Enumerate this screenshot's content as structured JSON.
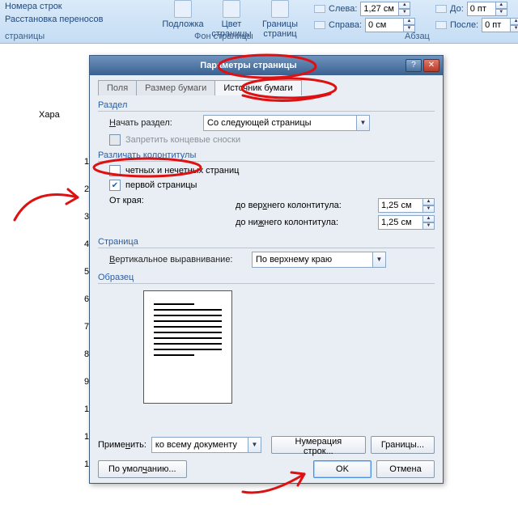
{
  "ribbon": {
    "items": {
      "line_numbers": "Номера строк",
      "hyphenation": "Расстановка переносов",
      "watermark": "Подложка",
      "page_color": "Цвет\nстраницы",
      "borders": "Границы\nстраниц"
    },
    "groups": {
      "page_setup": "страницы",
      "page_background": "Фон страницы",
      "paragraph": "Абзац"
    },
    "indent": {
      "left_label": "Слева:",
      "left_value": "1,27 см",
      "right_label": "Справа:",
      "right_value": "0 см"
    },
    "spacing": {
      "before_label": "До:",
      "before_value": "0 пт",
      "after_label": "После:",
      "after_value": "0 пт"
    }
  },
  "doc": {
    "text1": "Хара",
    "nums": [
      "1",
      "2",
      "3",
      "4",
      "5",
      "6",
      "7",
      "8",
      "9",
      "1",
      "1",
      "1"
    ]
  },
  "dialog": {
    "title": "Параметры страницы",
    "tabs": {
      "fields": "Поля",
      "paper": "Размер бумаги",
      "source": "Источник бумаги"
    },
    "section": {
      "legend": "Раздел",
      "start_label": "Начать раздел:",
      "start_value": "Со следующей страницы",
      "suppress_endnotes": "Запретить концевые сноски"
    },
    "headers": {
      "legend": "Различать колонтитулы",
      "odd_even": "четных и нечетных страниц",
      "first_page": "первой страницы",
      "from_edge": "От края:",
      "header_label": "до верхнего колонтитула:",
      "header_value": "1,25 см",
      "footer_label": "до нижнего колонтитула:",
      "footer_value": "1,25 см"
    },
    "page": {
      "legend": "Страница",
      "valign_label": "Вертикальное выравнивание:",
      "valign_value": "По верхнему краю"
    },
    "preview_legend": "Образец",
    "apply": {
      "label": "Применить:",
      "value": "ко всему документу"
    },
    "buttons": {
      "line_numbers": "Нумерация строк...",
      "borders": "Границы...",
      "default": "По умолчанию...",
      "ok": "OK",
      "cancel": "Отмена"
    }
  }
}
